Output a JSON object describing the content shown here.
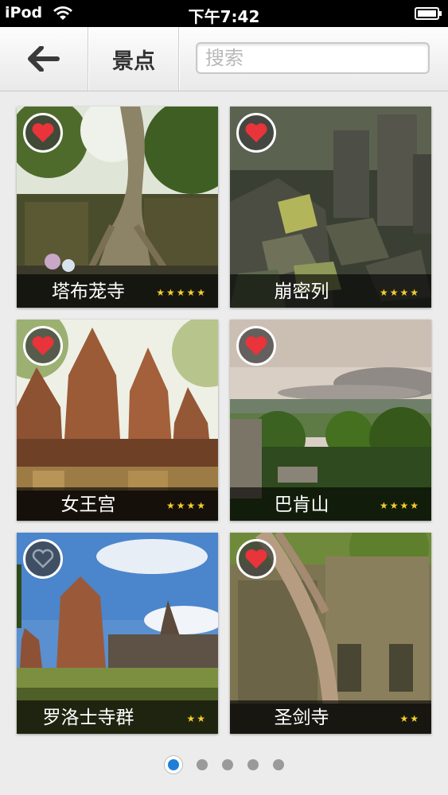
{
  "status_bar": {
    "carrier": "iPod",
    "time": "下午7:42"
  },
  "nav": {
    "title": "景点",
    "search_placeholder": "搜索",
    "back_icon": "back-arrow-icon"
  },
  "attractions": [
    {
      "name": "塔布茏寺",
      "stars": "★★★★★",
      "rating": 5,
      "favorited": true
    },
    {
      "name": "崩密列",
      "stars": "★★★★",
      "rating": 4,
      "favorited": true
    },
    {
      "name": "女王宫",
      "stars": "★★★★",
      "rating": 4,
      "favorited": true
    },
    {
      "name": "巴肯山",
      "stars": "★★★★",
      "rating": 4,
      "favorited": true
    },
    {
      "name": "罗洛士寺群",
      "stars": "★★",
      "rating": 2,
      "favorited": false
    },
    {
      "name": "圣剑寺",
      "stars": "★★",
      "rating": 2,
      "favorited": true
    }
  ],
  "pager": {
    "count": 5,
    "active": 0
  },
  "colors": {
    "heart": "#e8343a",
    "star": "#f4cf2a",
    "page_active": "#1f7fd8"
  }
}
